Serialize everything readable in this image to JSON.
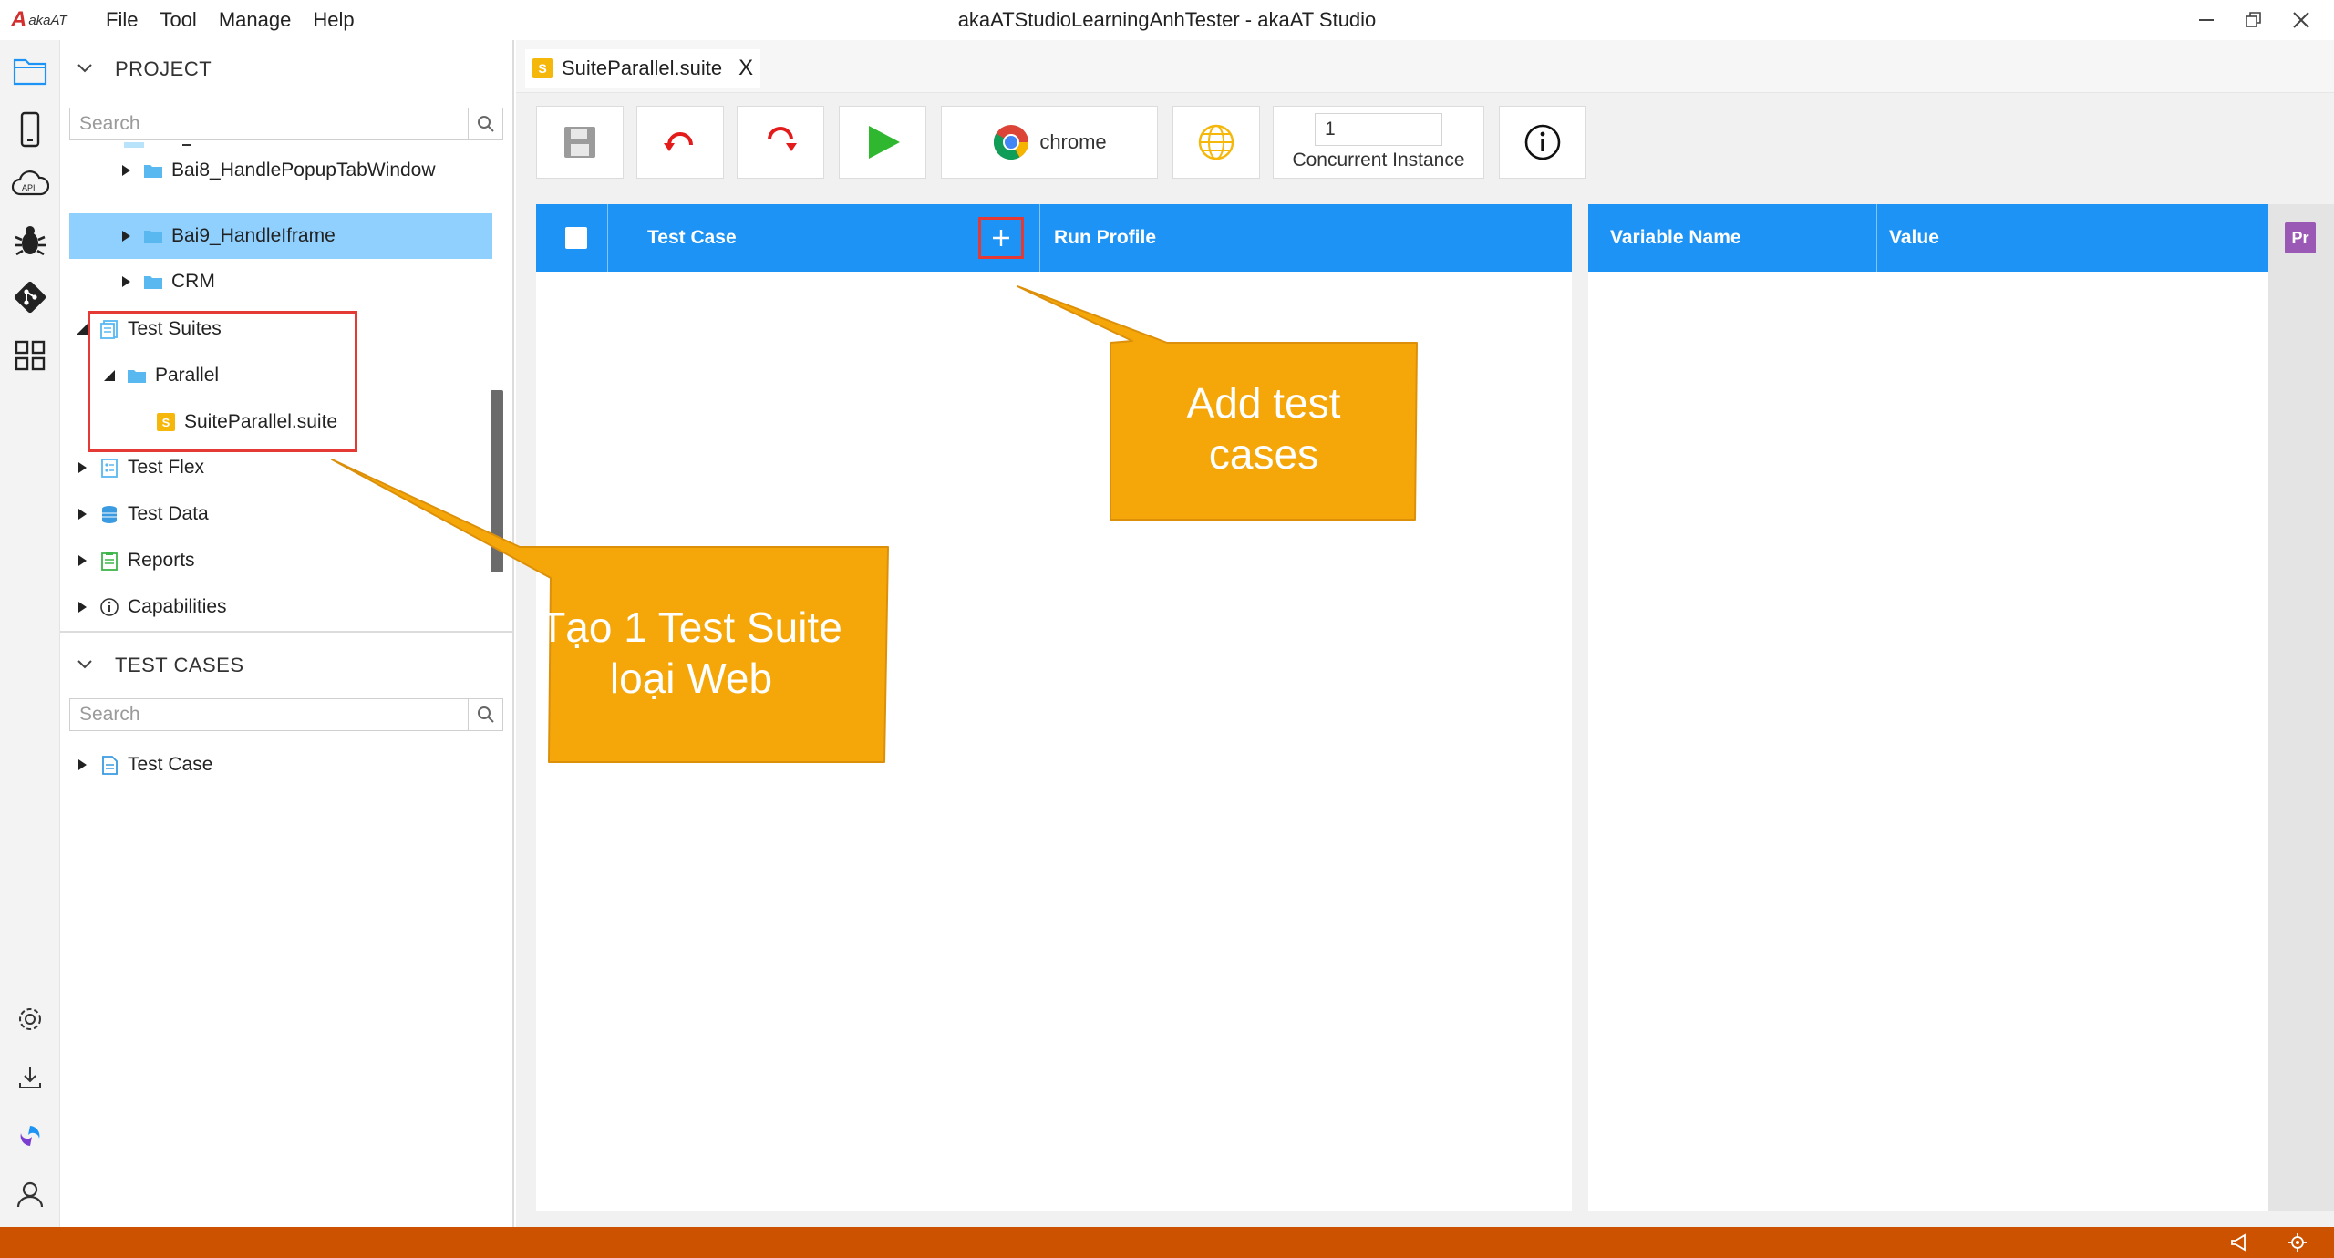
{
  "app": {
    "logo_mark": "A",
    "logo_text": "akaAT",
    "window_title": "akaATStudioLearningAnhTester - akaAT Studio",
    "menu": [
      "File",
      "Tool",
      "Manage",
      "Help"
    ]
  },
  "activity_bar": {
    "icons": [
      "explorer-icon",
      "mobile-icon",
      "api-cloud-icon",
      "bug-icon",
      "git-icon",
      "extensions-icon",
      "settings-icon",
      "download-icon",
      "swirl-logo-icon",
      "user-icon"
    ]
  },
  "project": {
    "title": "PROJECT",
    "search_placeholder": "Search",
    "tree": [
      {
        "label": "Bai8_HandlePopupTabWindow",
        "icon": "folder-icon"
      },
      {
        "label": "Bai9_HandleIframe",
        "icon": "folder-icon",
        "selected": true
      },
      {
        "label": "CRM",
        "icon": "folder-icon"
      },
      {
        "label": "Test Suites",
        "icon": "test-suites-icon"
      },
      {
        "label": "Parallel",
        "icon": "folder-icon"
      },
      {
        "label": "SuiteParallel.suite",
        "icon": "suite-file-icon",
        "badge": "S"
      },
      {
        "label": "Test Flex",
        "icon": "test-flex-icon"
      },
      {
        "label": "Test Data",
        "icon": "database-icon"
      },
      {
        "label": "Reports",
        "icon": "reports-icon"
      },
      {
        "label": "Capabilities",
        "icon": "info-icon"
      }
    ]
  },
  "test_cases": {
    "title": "TEST CASES",
    "search_placeholder": "Search",
    "tree": [
      {
        "label": "Test Case",
        "icon": "test-case-icon"
      }
    ]
  },
  "editor": {
    "tab": {
      "label": "SuiteParallel.suite",
      "badge": "S",
      "close": "X"
    },
    "toolbar": {
      "browser_label": "chrome",
      "concurrent_value": "1",
      "concurrent_label": "Concurrent Instance"
    },
    "table_headers": {
      "test_case": "Test Case",
      "add": "+",
      "run_profile": "Run Profile",
      "variable_name": "Variable Name",
      "value": "Value"
    },
    "profile_badge": "Pr"
  },
  "annotations": {
    "callout_suite_line1": "Tạo 1 Test Suite",
    "callout_suite_line2": "loại Web",
    "callout_add_line1": "Add test",
    "callout_add_line2": "cases"
  },
  "colors": {
    "accent": "#1d93f5",
    "selected_row": "#8fd0ff",
    "status_bar": "#cc5200",
    "callout": "#f5a70a",
    "highlight": "#e53935",
    "run_green": "#2fb82f",
    "reload_red": "#e31b1b"
  }
}
